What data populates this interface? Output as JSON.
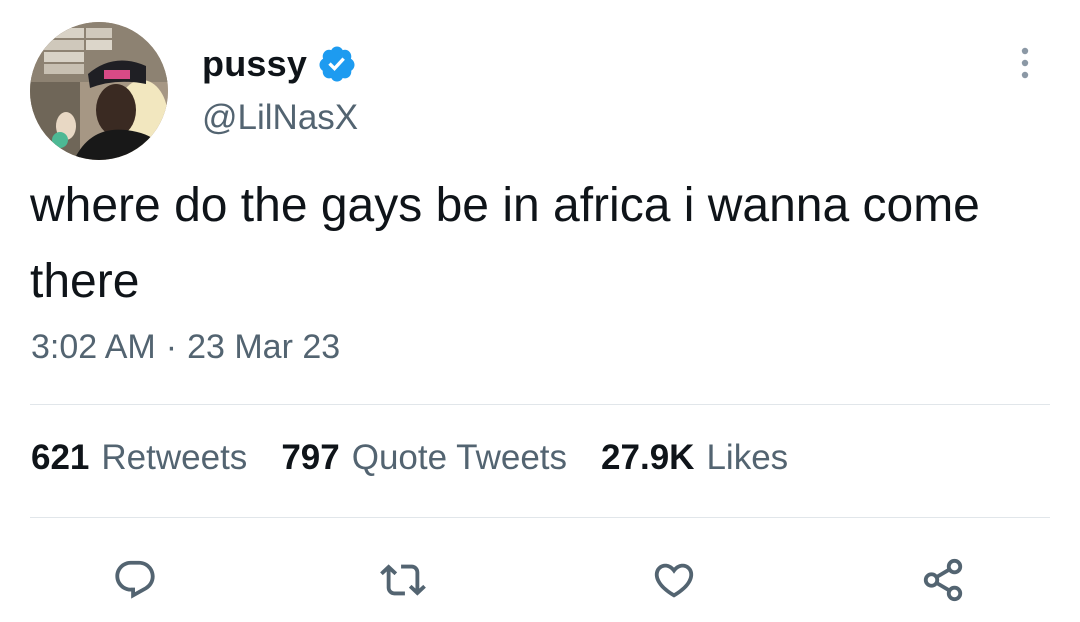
{
  "tweet": {
    "display_name": "pussy",
    "verified": true,
    "handle": "@LilNasX",
    "text": "where do the gays be in africa i wanna come there",
    "time": "3:02 AM",
    "separator": "·",
    "date": "23 Mar 23",
    "stats": {
      "retweets": {
        "count": "621",
        "label": "Retweets"
      },
      "quotes": {
        "count": "797",
        "label": "Quote Tweets"
      },
      "likes": {
        "count": "27.9K",
        "label": "Likes"
      }
    }
  },
  "icons": {
    "verified": "verified-badge-icon",
    "more": "more-vertical-icon",
    "reply": "reply-icon",
    "retweet": "retweet-icon",
    "like": "heart-icon",
    "share": "share-icon"
  },
  "colors": {
    "text_primary": "#0f1419",
    "text_secondary": "#536471",
    "verified_blue": "#1d9bf0",
    "divider": "#e1e6ea"
  }
}
